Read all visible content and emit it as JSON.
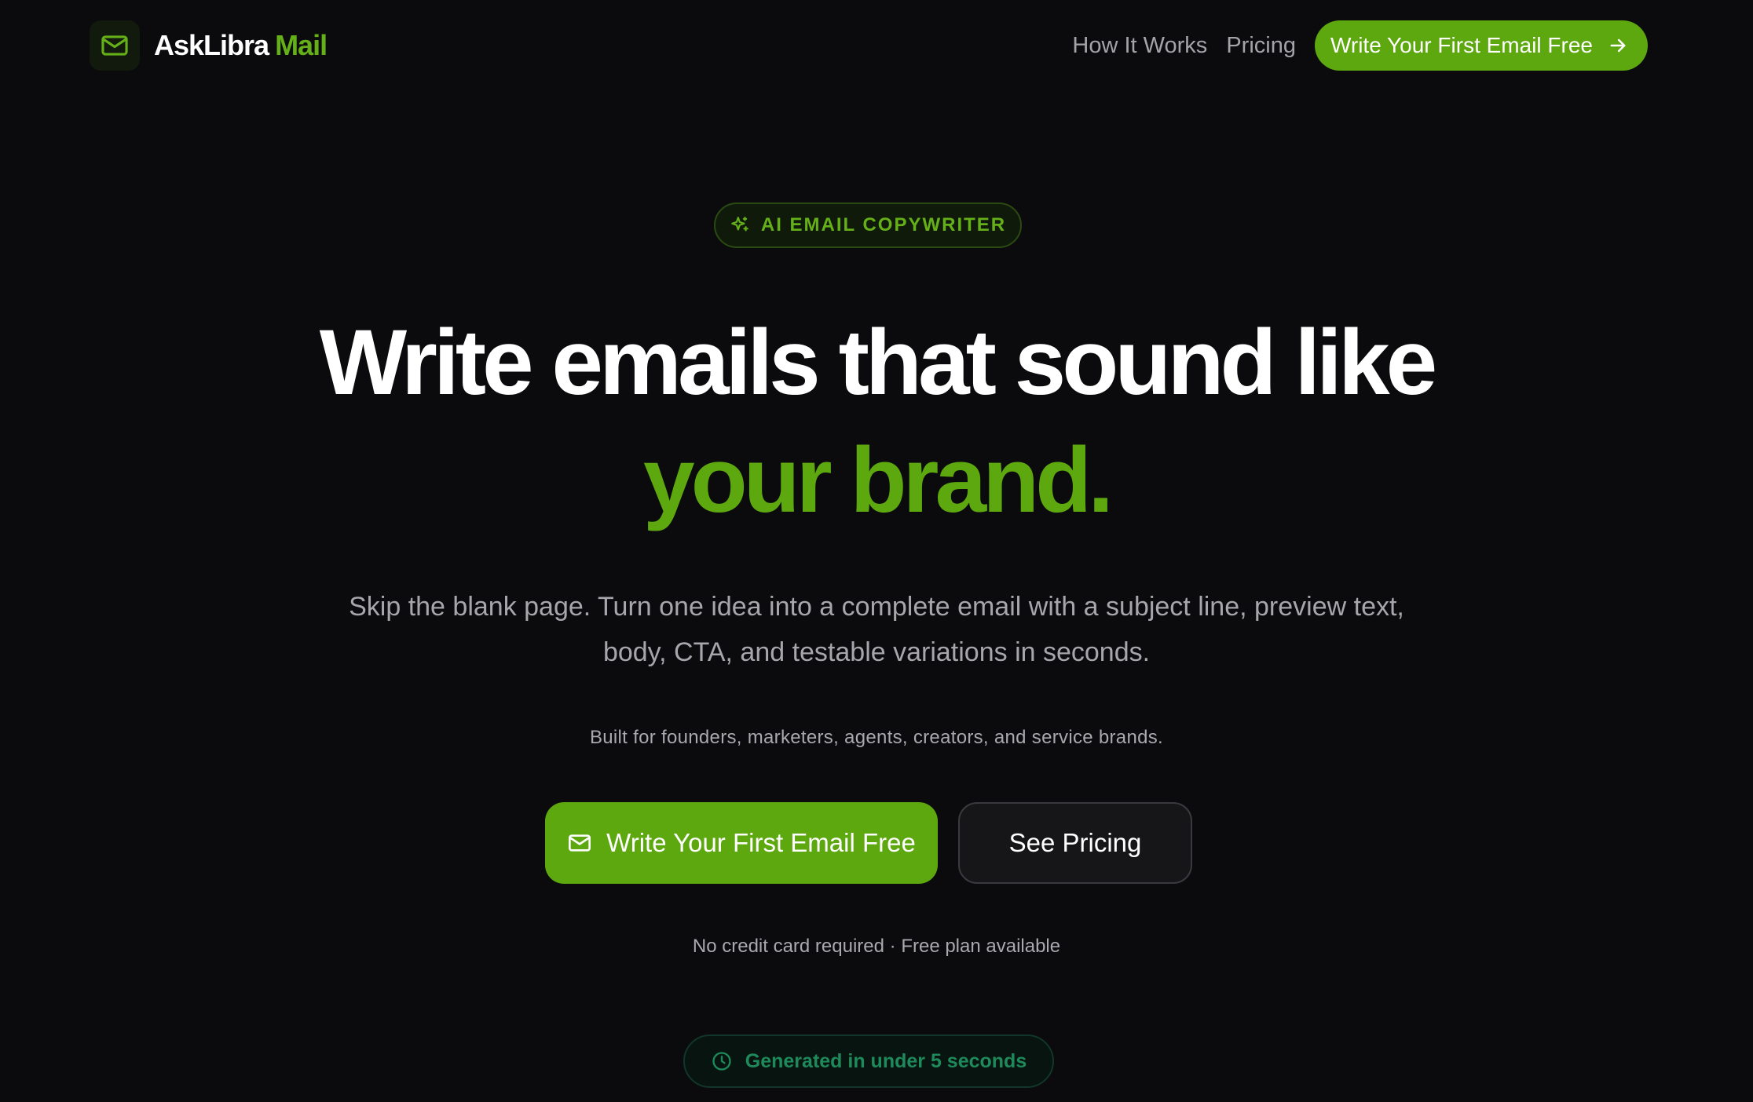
{
  "header": {
    "brand_name": "AskLibra",
    "brand_accent": "Mail",
    "logo_icon": "mail-icon",
    "nav": [
      {
        "label": "How It Works"
      },
      {
        "label": "Pricing"
      }
    ],
    "cta_label": "Write Your First Email Free",
    "cta_icon": "arrow-right-icon"
  },
  "hero": {
    "badge_label": "AI EMAIL COPYWRITER",
    "badge_icon": "sparkle-icon",
    "headline_line1": "Write emails that sound like",
    "headline_line2": "your brand.",
    "subtext": "Skip the blank page. Turn one idea into a complete email with a subject line, preview text, body, CTA, and testable variations in seconds.",
    "audience": "Built for founders, marketers, agents, creators, and service brands.",
    "primary_button": "Write Your First Email Free",
    "primary_icon": "mail-icon",
    "secondary_button": "See Pricing",
    "note": "No credit card required · Free plan available",
    "speed_badge": "Generated in under 5 seconds",
    "speed_icon": "clock-icon"
  },
  "colors": {
    "background": "#0b0b0d",
    "accent": "#5da70f",
    "accent_text": "#65b018",
    "muted_text": "#a6a6ab",
    "speed_green": "#1e8a5b"
  }
}
